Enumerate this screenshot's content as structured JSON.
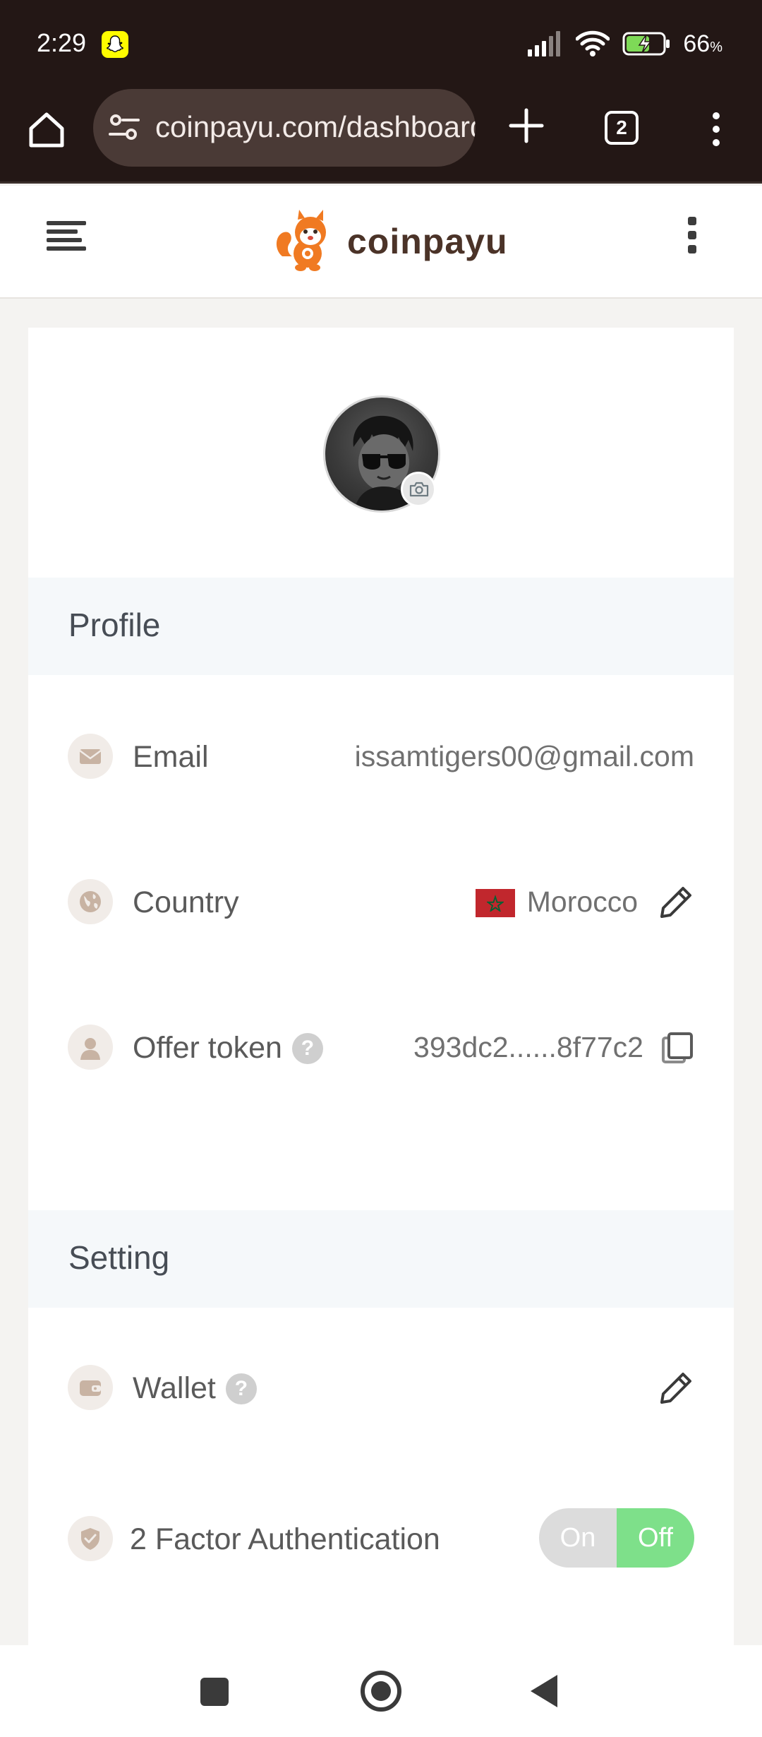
{
  "status_bar": {
    "time": "2:29",
    "battery_percent": "66",
    "battery_suffix": "%",
    "battery_level": 0.66,
    "battery_charging": true,
    "icons": [
      "snapchat-icon",
      "signal-icon",
      "wifi-icon",
      "battery-icon"
    ]
  },
  "browser": {
    "url": "coinpayu.com/dashboard",
    "tab_count": "2",
    "icons": [
      "home-icon",
      "site-settings-icon",
      "new-tab-icon",
      "tab-switcher-icon",
      "more-menu-icon"
    ]
  },
  "site": {
    "brand": "coinpayu",
    "colors": {
      "brand_text": "#4b3328",
      "logo_orange": "#f07a22"
    }
  },
  "profile": {
    "section_title": "Profile",
    "email": {
      "label": "Email",
      "value": "issamtigers00@gmail.com"
    },
    "country": {
      "label": "Country",
      "value": "Morocco"
    },
    "offer_token": {
      "label": "Offer token",
      "help": "?",
      "value": "393dc2......8f77c2"
    }
  },
  "setting": {
    "section_title": "Setting",
    "wallet": {
      "label": "Wallet",
      "help": "?"
    },
    "two_factor": {
      "label": "2 Factor Authentication",
      "on_label": "On",
      "off_label": "Off",
      "state": "Off"
    }
  },
  "colors": {
    "status_bar_bg": "#231715",
    "section_head_bg": "#f5f8fa",
    "toggle_active": "#7ee08a",
    "toggle_inactive": "#dcdcdc"
  }
}
